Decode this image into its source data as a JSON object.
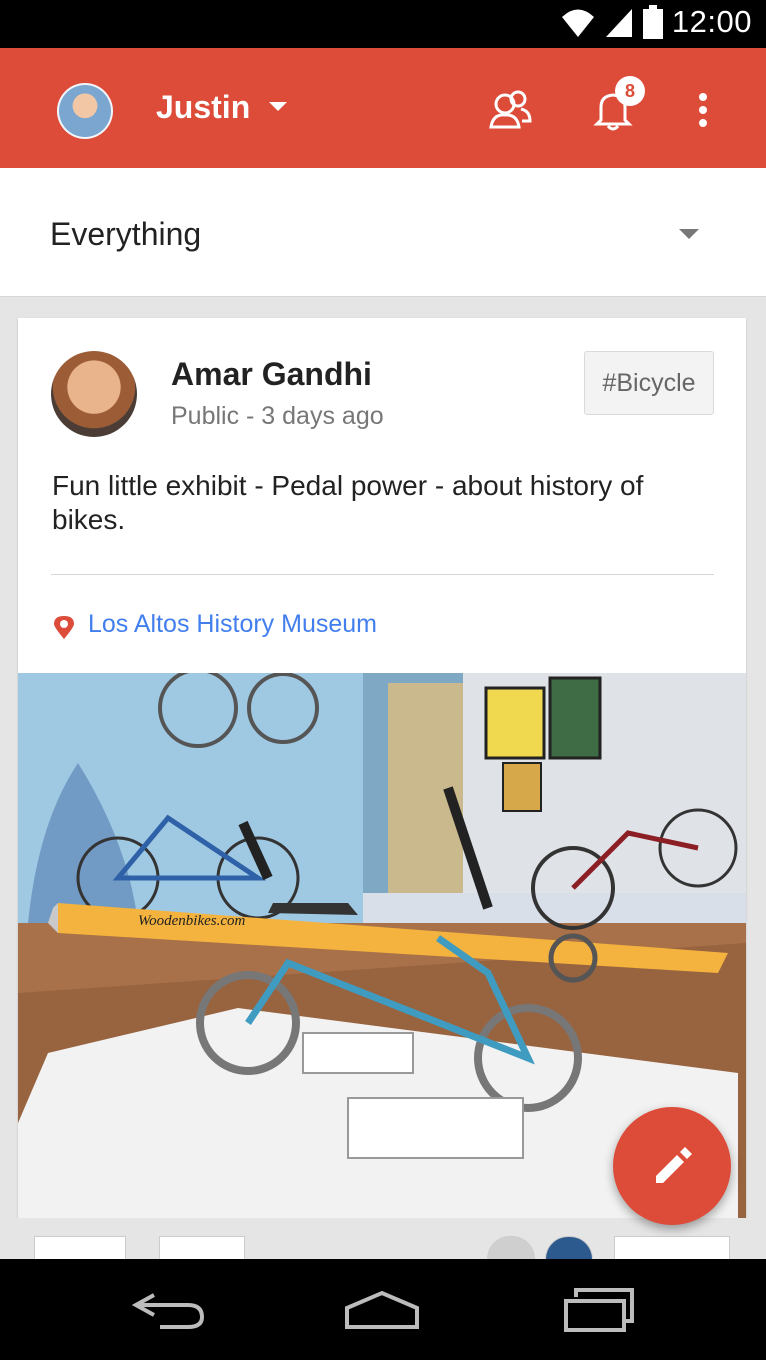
{
  "status_bar": {
    "time": "12:00",
    "icons": [
      "wifi-icon",
      "signal-icon",
      "battery-icon"
    ]
  },
  "app_bar": {
    "account_name": "Justin",
    "notification_count": "8",
    "icons": [
      "account-avatar",
      "people-icon",
      "bell-icon",
      "overflow-menu-icon"
    ],
    "color": "#dd4b39"
  },
  "filter": {
    "selected": "Everything"
  },
  "post": {
    "author": "Amar Gandhi",
    "meta": "Public - 3 days ago",
    "hashtag": "#Bicycle",
    "text": "Fun little exhibit - Pedal power - about history of bikes.",
    "location": "Los Altos History Museum",
    "location_color": "#427fed",
    "photo_watermark": "Woodenbikes.com"
  },
  "fab": {
    "icon": "pencil-icon"
  },
  "nav": {
    "icons": [
      "back-icon",
      "home-icon",
      "recents-icon"
    ]
  }
}
